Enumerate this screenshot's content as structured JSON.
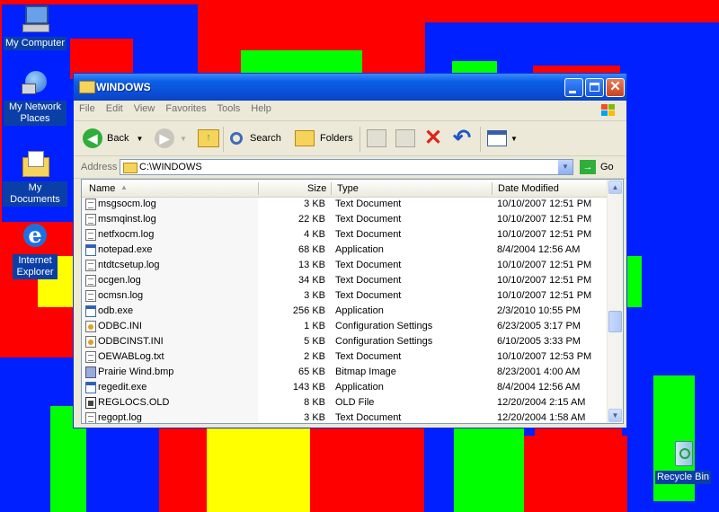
{
  "desktop": {
    "icons": [
      {
        "label": "My Computer",
        "icon": "my-computer-icon"
      },
      {
        "label": "My Network Places",
        "icon": "network-places-icon"
      },
      {
        "label": "My Documents",
        "icon": "my-documents-icon"
      },
      {
        "label": "Internet Explorer",
        "icon": "internet-explorer-icon"
      },
      {
        "label": "Recycle Bin",
        "icon": "recycle-bin-icon"
      }
    ]
  },
  "window": {
    "title": "WINDOWS",
    "menu": [
      "File",
      "Edit",
      "View",
      "Favorites",
      "Tools",
      "Help"
    ],
    "toolbar": {
      "back": "Back",
      "search": "Search",
      "folders": "Folders"
    },
    "address": {
      "label": "Address",
      "value": "C:\\WINDOWS",
      "go": "Go"
    },
    "columns": {
      "name": "Name",
      "size": "Size",
      "type": "Type",
      "date": "Date Modified"
    },
    "files": [
      {
        "name": "msgsocm.log",
        "size": "3 KB",
        "type": "Text Document",
        "date": "10/10/2007 12:51 PM",
        "kind": "doc"
      },
      {
        "name": "msmqinst.log",
        "size": "22 KB",
        "type": "Text Document",
        "date": "10/10/2007 12:51 PM",
        "kind": "doc"
      },
      {
        "name": "netfxocm.log",
        "size": "4 KB",
        "type": "Text Document",
        "date": "10/10/2007 12:51 PM",
        "kind": "doc"
      },
      {
        "name": "notepad.exe",
        "size": "68 KB",
        "type": "Application",
        "date": "8/4/2004 12:56 AM",
        "kind": "app"
      },
      {
        "name": "ntdtcsetup.log",
        "size": "13 KB",
        "type": "Text Document",
        "date": "10/10/2007 12:51 PM",
        "kind": "doc"
      },
      {
        "name": "ocgen.log",
        "size": "34 KB",
        "type": "Text Document",
        "date": "10/10/2007 12:51 PM",
        "kind": "doc"
      },
      {
        "name": "ocmsn.log",
        "size": "3 KB",
        "type": "Text Document",
        "date": "10/10/2007 12:51 PM",
        "kind": "doc"
      },
      {
        "name": "odb.exe",
        "size": "256 KB",
        "type": "Application",
        "date": "2/3/2010 10:55 PM",
        "kind": "app"
      },
      {
        "name": "ODBC.INI",
        "size": "1 KB",
        "type": "Configuration Settings",
        "date": "6/23/2005 3:17 PM",
        "kind": "cfg"
      },
      {
        "name": "ODBCINST.INI",
        "size": "5 KB",
        "type": "Configuration Settings",
        "date": "6/10/2005 3:33 PM",
        "kind": "cfg"
      },
      {
        "name": "OEWABLog.txt",
        "size": "2 KB",
        "type": "Text Document",
        "date": "10/10/2007 12:53 PM",
        "kind": "doc"
      },
      {
        "name": "Prairie Wind.bmp",
        "size": "65 KB",
        "type": "Bitmap Image",
        "date": "8/23/2001 4:00 AM",
        "kind": "img"
      },
      {
        "name": "regedit.exe",
        "size": "143 KB",
        "type": "Application",
        "date": "8/4/2004 12:56 AM",
        "kind": "app"
      },
      {
        "name": "REGLOCS.OLD",
        "size": "8 KB",
        "type": "OLD File",
        "date": "12/20/2004 2:15 AM",
        "kind": "old"
      },
      {
        "name": "regopt.log",
        "size": "3 KB",
        "type": "Text Document",
        "date": "12/20/2004 1:58 AM",
        "kind": "doc"
      }
    ]
  }
}
